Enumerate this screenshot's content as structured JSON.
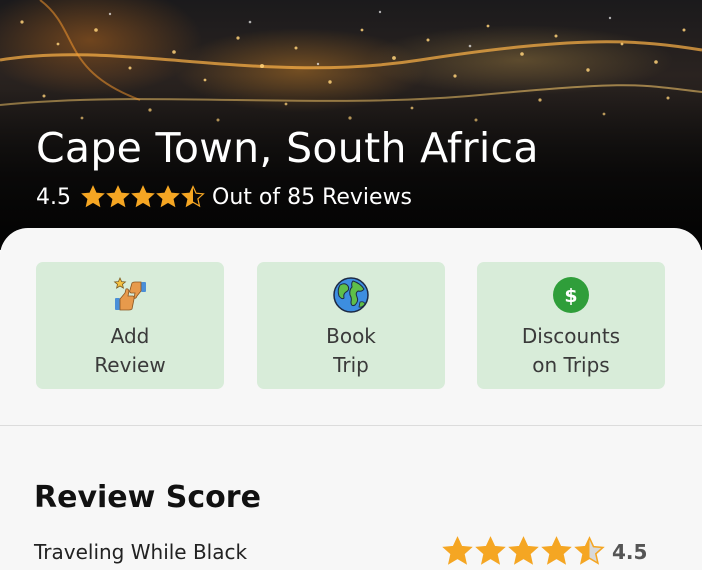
{
  "hero": {
    "title": "Cape Town, South Africa",
    "rating": "4.5",
    "rating_value": 4.5,
    "rating_max": 5,
    "reviews_text": "Out of 85 Reviews",
    "star_color": "#f5a623"
  },
  "actions": [
    {
      "label": "Add\nReview",
      "icon": "thumbs-review-icon"
    },
    {
      "label": "Book\nTrip",
      "icon": "globe-icon"
    },
    {
      "label": "Discounts\non Trips",
      "icon": "dollar-coin-icon"
    }
  ],
  "review_score": {
    "title": "Review Score",
    "items": [
      {
        "label": "Traveling While Black",
        "value": "4.5",
        "rating_value": 4.5
      }
    ]
  },
  "colors": {
    "card_bg": "#d8ecd9",
    "sheet_bg": "#f7f7f7",
    "star": "#f5a623"
  }
}
